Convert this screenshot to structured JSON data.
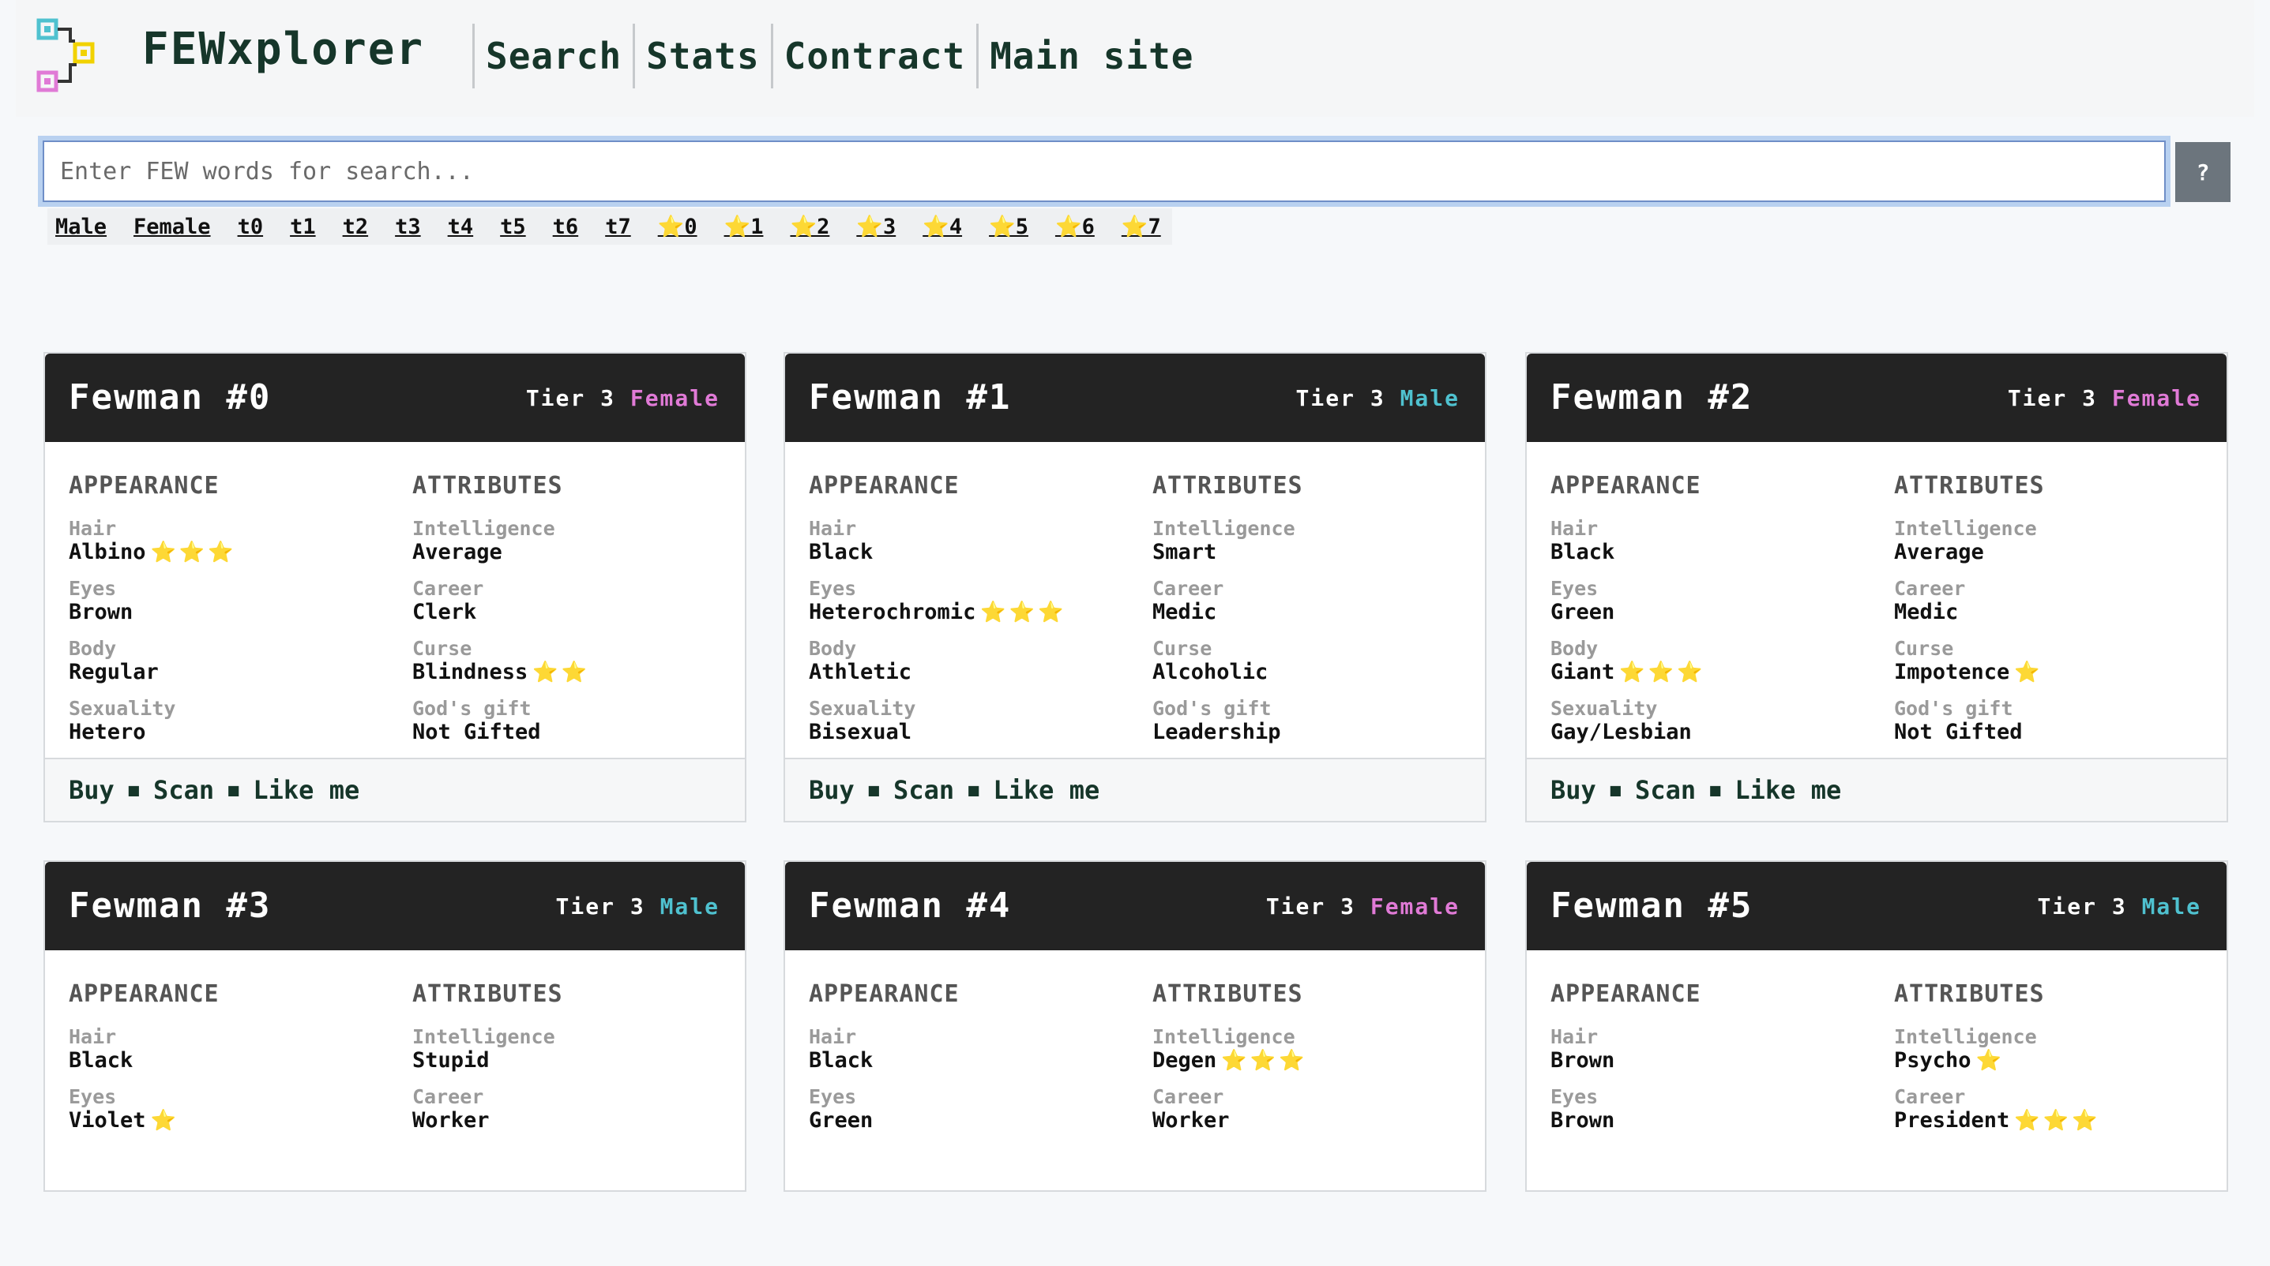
{
  "header": {
    "brand": "FEWxplorer",
    "nav": [
      "Search",
      "Stats",
      "Contract",
      "Main site"
    ]
  },
  "search": {
    "placeholder": "Enter FEW words for search...",
    "help_label": "?"
  },
  "filters": [
    "Male",
    "Female",
    "t0",
    "t1",
    "t2",
    "t3",
    "t4",
    "t5",
    "t6",
    "t7",
    "⭐0",
    "⭐1",
    "⭐2",
    "⭐3",
    "⭐4",
    "⭐5",
    "⭐6",
    "⭐7"
  ],
  "labels": {
    "appearance": "APPEARANCE",
    "attributes": "ATTRIBUTES",
    "hair": "Hair",
    "eyes": "Eyes",
    "body": "Body",
    "sexuality": "Sexuality",
    "intelligence": "Intelligence",
    "career": "Career",
    "curse": "Curse",
    "gift": "God's gift",
    "buy": "Buy",
    "scan": "Scan",
    "like": "Like me"
  },
  "cards": [
    {
      "title": "Fewman #0",
      "tier": "Tier 3",
      "gender": "Female",
      "hair": "Albino",
      "hair_stars": "⭐⭐⭐",
      "eyes": "Brown",
      "eyes_stars": "",
      "body": "Regular",
      "body_stars": "",
      "sexuality": "Hetero",
      "sexuality_stars": "",
      "intelligence": "Average",
      "intelligence_stars": "",
      "career": "Clerk",
      "career_stars": "",
      "curse": "Blindness",
      "curse_stars": "⭐⭐",
      "gift": "Not Gifted",
      "gift_stars": ""
    },
    {
      "title": "Fewman #1",
      "tier": "Tier 3",
      "gender": "Male",
      "hair": "Black",
      "hair_stars": "",
      "eyes": "Heterochromic",
      "eyes_stars": "⭐⭐⭐",
      "body": "Athletic",
      "body_stars": "",
      "sexuality": "Bisexual",
      "sexuality_stars": "",
      "intelligence": "Smart",
      "intelligence_stars": "",
      "career": "Medic",
      "career_stars": "",
      "curse": "Alcoholic",
      "curse_stars": "",
      "gift": "Leadership",
      "gift_stars": ""
    },
    {
      "title": "Fewman #2",
      "tier": "Tier 3",
      "gender": "Female",
      "hair": "Black",
      "hair_stars": "",
      "eyes": "Green",
      "eyes_stars": "",
      "body": "Giant",
      "body_stars": "⭐⭐⭐",
      "sexuality": "Gay/Lesbian",
      "sexuality_stars": "",
      "intelligence": "Average",
      "intelligence_stars": "",
      "career": "Medic",
      "career_stars": "",
      "curse": "Impotence",
      "curse_stars": "⭐",
      "gift": "Not Gifted",
      "gift_stars": ""
    },
    {
      "title": "Fewman #3",
      "tier": "Tier 3",
      "gender": "Male",
      "hair": "Black",
      "hair_stars": "",
      "eyes": "Violet",
      "eyes_stars": "⭐",
      "intelligence": "Stupid",
      "intelligence_stars": "",
      "career": "Worker",
      "career_stars": ""
    },
    {
      "title": "Fewman #4",
      "tier": "Tier 3",
      "gender": "Female",
      "hair": "Black",
      "hair_stars": "",
      "eyes": "Green",
      "eyes_stars": "",
      "intelligence": "Degen",
      "intelligence_stars": "⭐⭐⭐",
      "career": "Worker",
      "career_stars": ""
    },
    {
      "title": "Fewman #5",
      "tier": "Tier 3",
      "gender": "Male",
      "hair": "Brown",
      "hair_stars": "",
      "eyes": "Brown",
      "eyes_stars": "",
      "intelligence": "Psycho",
      "intelligence_stars": "⭐",
      "career": "President",
      "career_stars": "⭐⭐⭐"
    }
  ]
}
